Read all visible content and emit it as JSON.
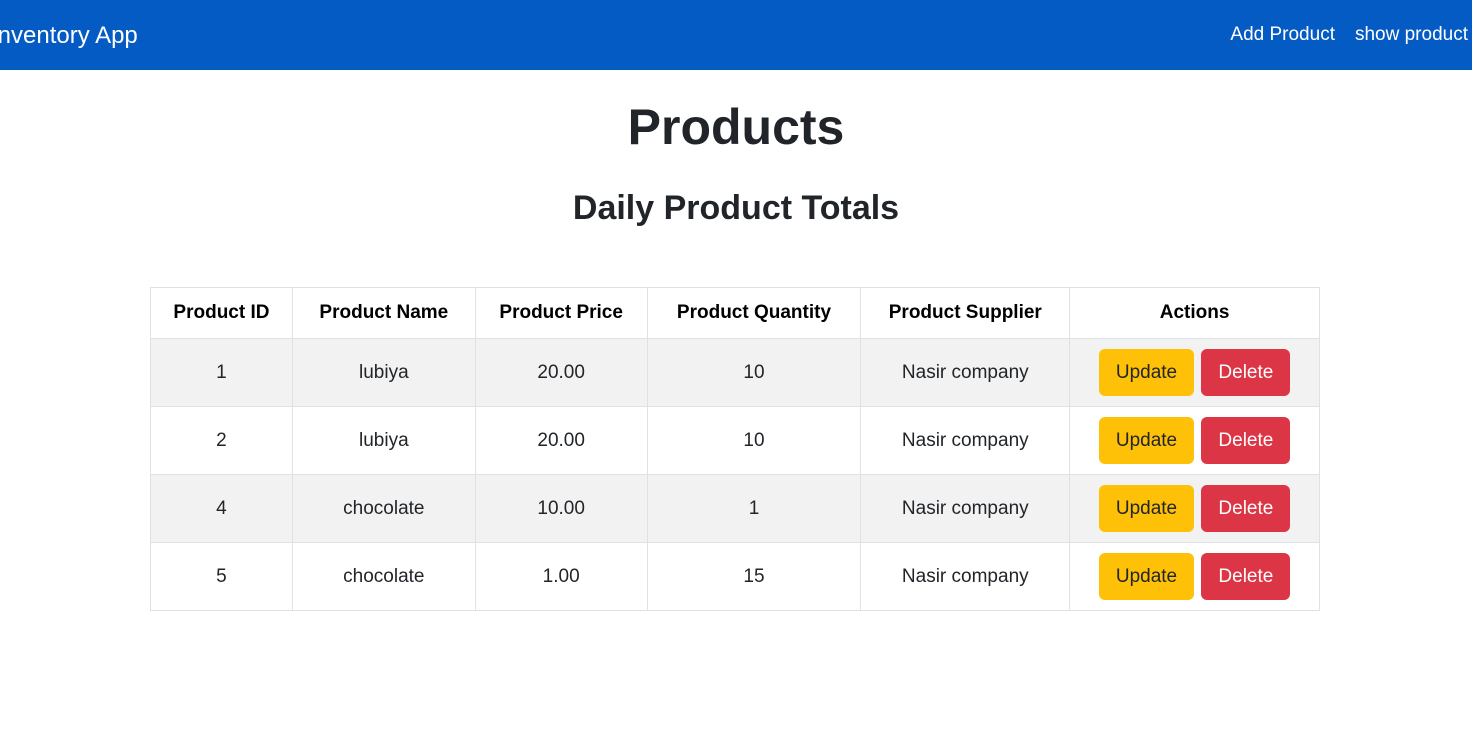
{
  "navbar": {
    "brand": "Inventory App",
    "links": [
      {
        "label": "Add Product"
      },
      {
        "label": "show product"
      }
    ]
  },
  "main": {
    "title": "Products",
    "subtitle": "Daily Product Totals"
  },
  "table": {
    "headers": [
      "Product ID",
      "Product Name",
      "Product Price",
      "Product Quantity",
      "Product Supplier",
      "Actions"
    ],
    "rows": [
      {
        "id": "1",
        "name": "lubiya",
        "price": "20.00",
        "quantity": "10",
        "supplier": "Nasir company",
        "update": "Update",
        "delete": "Delete"
      },
      {
        "id": "2",
        "name": "lubiya",
        "price": "20.00",
        "quantity": "10",
        "supplier": "Nasir company",
        "update": "Update",
        "delete": "Delete"
      },
      {
        "id": "4",
        "name": "chocolate",
        "price": "10.00",
        "quantity": "1",
        "supplier": "Nasir company",
        "update": "Update",
        "delete": "Delete"
      },
      {
        "id": "5",
        "name": "chocolate",
        "price": "1.00",
        "quantity": "15",
        "supplier": "Nasir company",
        "update": "Update",
        "delete": "Delete"
      }
    ]
  },
  "colors": {
    "navbar": "#055bc4",
    "update_button": "#ffc107",
    "delete_button": "#dc3545",
    "striped_row": "#f2f2f2"
  }
}
